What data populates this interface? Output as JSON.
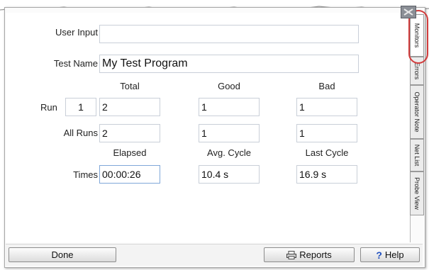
{
  "form": {
    "user_input_label": "User Input",
    "user_input_value": "",
    "test_name_label": "Test Name",
    "test_name_value": "My Test Program",
    "column_headers": {
      "total": "Total",
      "good": "Good",
      "bad": "Bad"
    },
    "run_label": "Run",
    "run_number": "1",
    "run_values": {
      "total": "2",
      "good": "1",
      "bad": "1"
    },
    "all_runs_label": "All Runs",
    "all_runs_values": {
      "total": "2",
      "good": "1",
      "bad": "1"
    },
    "time_headers": {
      "elapsed": "Elapsed",
      "avg_cycle": "Avg. Cycle",
      "last_cycle": "Last Cycle"
    },
    "times_label": "Times",
    "times_values": {
      "elapsed": "00:00:26",
      "avg_cycle": "10.4 s",
      "last_cycle": "16.9 s"
    }
  },
  "side_tabs": [
    "Monitors",
    "Errors",
    "Operator Note",
    "Net List",
    "Probe View"
  ],
  "buttons": {
    "done": "Done",
    "reports": "Reports",
    "help": "Help"
  },
  "colors": {
    "highlight_ring": "#d23c3c",
    "help_icon": "#1f4fbf"
  }
}
